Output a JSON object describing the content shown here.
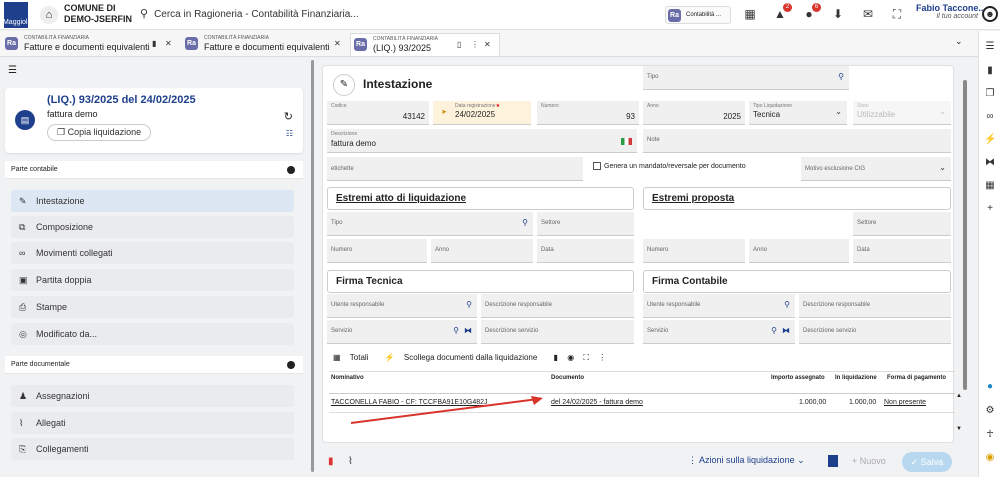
{
  "app": {
    "logo_text": "Maggioli",
    "org_line1": "COMUNE DI",
    "org_line2": "DEMO-JSERFIN"
  },
  "search": {
    "placeholder": "Cerca in Ragioneria - Contabilità Finanziaria..."
  },
  "context": {
    "badge": "Ra",
    "label": "Contabilità ..."
  },
  "notifications": {
    "alerts": "2",
    "bell": "6"
  },
  "user": {
    "name": "Fabio Taccone...",
    "account": "Il tuo account"
  },
  "tabs": [
    {
      "small": "CONTABILITÀ FINANZIARIA",
      "title": "Fatture e documenti equivalenti"
    },
    {
      "small": "CONTABILITÀ FINANZIARIA",
      "title": "Fatture e documenti equivalenti"
    },
    {
      "small": "CONTABILITÀ FINANZIARIA",
      "title": "(LIQ.) 93/2025"
    }
  ],
  "card": {
    "title": "(LIQ.) 93/2025 del 24/02/2025",
    "subtitle": "fattura demo",
    "copy_button": "Copia liquidazione"
  },
  "sections": {
    "contabile": "Parte contabile",
    "documentale": "Parte documentale"
  },
  "menu_contabile": [
    "Intestazione",
    "Composizione",
    "Movimenti collegati",
    "Partita doppia",
    "Stampe",
    "Modificato da..."
  ],
  "menu_documentale": [
    "Assegnazioni",
    "Allegati",
    "Collegamenti"
  ],
  "form": {
    "heading": "Intestazione",
    "codice_label": "Codice",
    "codice_value": "43142",
    "data_label": "Data registrazione",
    "data_value": "24/02/2025",
    "numero_label": "Numero",
    "numero_value": "93",
    "anno_label": "Anno",
    "anno_value": "2025",
    "tipo_label": "Tipo Liquidazione",
    "tipo_value": "Tecnica",
    "stato_label": "Stato",
    "stato_value": "Utilizzabile",
    "descr_label": "Descrizione",
    "descr_value": "fattura demo",
    "note_placeholder": "Note",
    "etichette_placeholder": "etichette",
    "genera_label": "Genera un mandato/reversale per documento",
    "motivo_placeholder": "Motivo esclusione CIG"
  },
  "estremi_atto": {
    "title": "Estremi atto di liquidazione",
    "tipo": "Tipo",
    "settore": "Settore",
    "numero": "Numero",
    "anno": "Anno",
    "data": "Data"
  },
  "estremi_proposta": {
    "title": "Estremi proposta",
    "tipo": "Tipo",
    "settore": "Settore",
    "numero": "Numero",
    "anno": "Anno",
    "data": "Data"
  },
  "firma_tecnica": {
    "title": "Firma Tecnica",
    "utente": "Utente responsabile",
    "descr_resp": "Descrizione responsabile",
    "servizio": "Servizio",
    "descr_serv": "Descrizione servizio"
  },
  "firma_contabile": {
    "title": "Firma Contabile",
    "utente": "Utente responsabile",
    "descr_resp": "Descrizione responsabile",
    "servizio": "Servizio",
    "descr_serv": "Descrizione servizio"
  },
  "grid_toolbar": {
    "totali": "Totali",
    "scollega": "Scollega documenti dalla liquidazione"
  },
  "grid": {
    "headers": [
      "Nominativo",
      "Documento",
      "Importo assegnato",
      "In liquidazione",
      "Forma di pagamento"
    ],
    "rows": [
      [
        "TACCONELLA FABIO - CF: TCCFBA91E10G482J",
        "del 24/02/2025 - fattura demo",
        "1.000,00",
        "1.000,00",
        "Non presente"
      ]
    ]
  },
  "bottom": {
    "azioni": "Azioni sulla liquidazione",
    "nuovo": "Nuovo",
    "salva": "Salva"
  },
  "colors": {
    "brand": "#1e3f8c",
    "active_item": "#dde6f3",
    "arrow": "#d9342b"
  }
}
